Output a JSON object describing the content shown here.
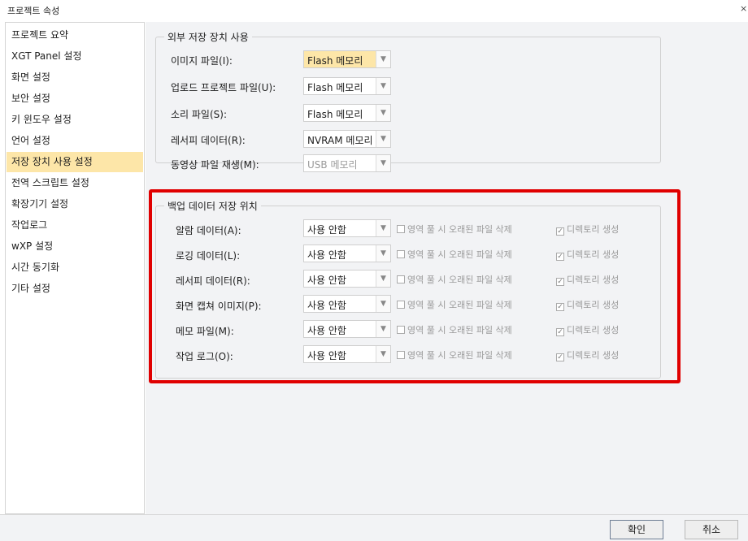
{
  "window": {
    "title": "프로젝트 속성",
    "close_glyph": "×"
  },
  "sidebar": {
    "items": [
      {
        "label": "프로젝트 요약"
      },
      {
        "label": "XGT Panel 설정"
      },
      {
        "label": "화면 설정"
      },
      {
        "label": "보안 설정"
      },
      {
        "label": "키 윈도우 설정"
      },
      {
        "label": "언어 설정"
      },
      {
        "label": "저장 장치 사용 설정",
        "selected": true
      },
      {
        "label": "전역 스크립트 설정"
      },
      {
        "label": "확장기기 설정"
      },
      {
        "label": "작업로그"
      },
      {
        "label": "wXP 설정"
      },
      {
        "label": "시간 동기화"
      },
      {
        "label": "기타 설정"
      }
    ]
  },
  "external_storage": {
    "legend": "외부 저장 장치 사용",
    "rows": [
      {
        "label": "이미지 파일(I):",
        "value": "Flash 메모리",
        "highlight": true
      },
      {
        "label": "업로드 프로젝트 파일(U):",
        "value": "Flash 메모리"
      },
      {
        "label": "소리 파일(S):",
        "value": "Flash 메모리"
      },
      {
        "label": "레서피 데이터(R):",
        "value": "NVRAM 메모리"
      },
      {
        "label": "동영상 파일 재생(M):",
        "value": "USB 메모리",
        "disabled": true
      }
    ]
  },
  "backup_location": {
    "legend": "백업 데이터 저장 위치",
    "checkbox_delete_label": "영역 풀 시 오래된 파일 삭제",
    "checkbox_dir_label": "디렉토리 생성",
    "rows": [
      {
        "label": "알람 데이터(A):",
        "value": "사용 안함",
        "delete_checked": false,
        "dir_checked": true
      },
      {
        "label": "로깅 데이터(L):",
        "value": "사용 안함",
        "delete_checked": false,
        "dir_checked": true
      },
      {
        "label": "레서피 데이터(R):",
        "value": "사용 안함",
        "delete_checked": false,
        "dir_checked": true
      },
      {
        "label": "화면 캡쳐 이미지(P):",
        "value": "사용 안함",
        "delete_checked": false,
        "dir_checked": true
      },
      {
        "label": "메모 파일(M):",
        "value": "사용 안함",
        "delete_checked": false,
        "dir_checked": true
      },
      {
        "label": "작업 로그(O):",
        "value": "사용 안함",
        "delete_checked": false,
        "dir_checked": true
      }
    ]
  },
  "footer": {
    "ok_label": "확인",
    "cancel_label": "취소"
  },
  "colors": {
    "selection": "#fde6a8",
    "highlight_border": "#e00000",
    "panel_bg": "#f2f3f5"
  },
  "icons": {
    "dropdown": "chevron-down-icon",
    "checkbox_checked": "check-icon"
  }
}
